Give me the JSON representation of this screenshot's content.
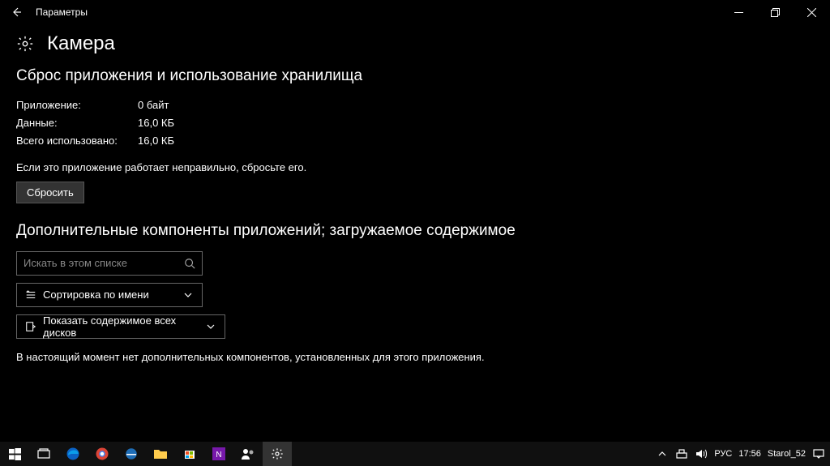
{
  "titlebar": {
    "title": "Параметры"
  },
  "page": {
    "title": "Камера"
  },
  "reset_section": {
    "heading": "Сброс приложения и использование хранилища",
    "rows": [
      {
        "label": "Приложение:",
        "value": "0 байт"
      },
      {
        "label": "Данные:",
        "value": "16,0 КБ"
      },
      {
        "label": "Всего использовано:",
        "value": "16,0 КБ"
      }
    ],
    "helper": "Если это приложение работает неправильно, сбросьте его.",
    "button": "Сбросить"
  },
  "addons_section": {
    "heading": "Дополнительные компоненты приложений; загружаемое содержимое",
    "search_placeholder": "Искать в этом списке",
    "sort_label": "Сортировка по имени",
    "drive_label": "Показать содержимое всех дисков",
    "empty": "В настоящий момент нет дополнительных компонентов, установленных для этого приложения."
  },
  "taskbar": {
    "lang": "РУС",
    "time": "17:56",
    "user": "Starol_52"
  }
}
